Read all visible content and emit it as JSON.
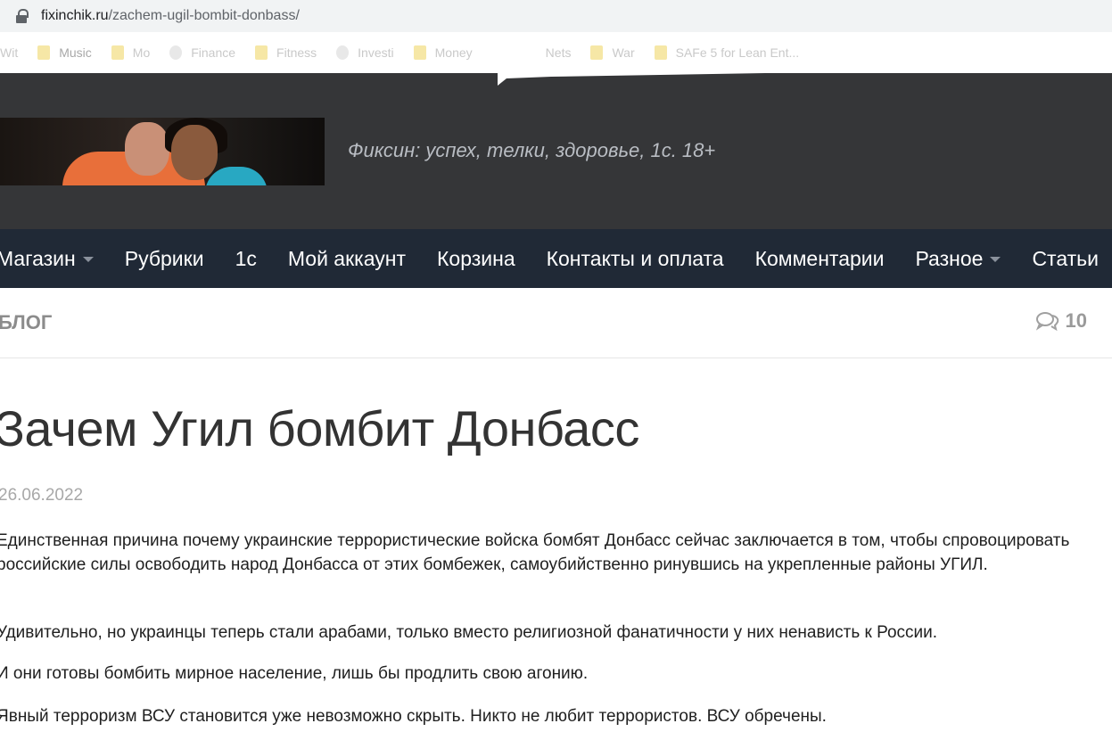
{
  "browser": {
    "url_domain": "fixinchik.ru",
    "url_path": "/zachem-ugil-bombit-donbass/",
    "bookmarks": [
      "Wit",
      "Music",
      "Mo",
      "Finance",
      "Fitness",
      "Investi",
      "Money",
      "Nets",
      "War",
      "SAFe 5 for Lean Ent..."
    ]
  },
  "site": {
    "tagline": "Фиксин: успех, телки, здоровье, 1с. 18+"
  },
  "nav": {
    "items": [
      {
        "label": "Магазин"
      },
      {
        "label": "Рубрики"
      },
      {
        "label": "1с"
      },
      {
        "label": "Мой аккаунт"
      },
      {
        "label": "Корзина"
      },
      {
        "label": "Контакты и оплата"
      },
      {
        "label": "Комментарии"
      },
      {
        "label": "Разное"
      },
      {
        "label": "Статьи"
      }
    ]
  },
  "category": {
    "label": "БЛОГ",
    "comment_count": "10"
  },
  "article": {
    "title": "Зачем Угил бомбит Донбасс",
    "date": "26.06.2022",
    "paragraphs": [
      "Единственная причина почему украинские террористические войска бомбят Донбасс сейчас заключается в том, чтобы спровоцировать российские силы освободить народ Донбасса от этих бомбежек, самоубийственно ринувшись на укрепленные районы УГИЛ.",
      "Удивительно, но украинцы теперь стали арабами, только вместо религиозной фанатичности у них ненависть к России.",
      "И они готовы бомбить мирное население, лишь бы продлить свою агонию.",
      "Явный терроризм ВСУ становится уже невозможно скрыть. Никто не любит террористов. ВСУ обречены."
    ]
  },
  "colors": {
    "header_bg": "#353638",
    "nav_bg": "#202936"
  }
}
